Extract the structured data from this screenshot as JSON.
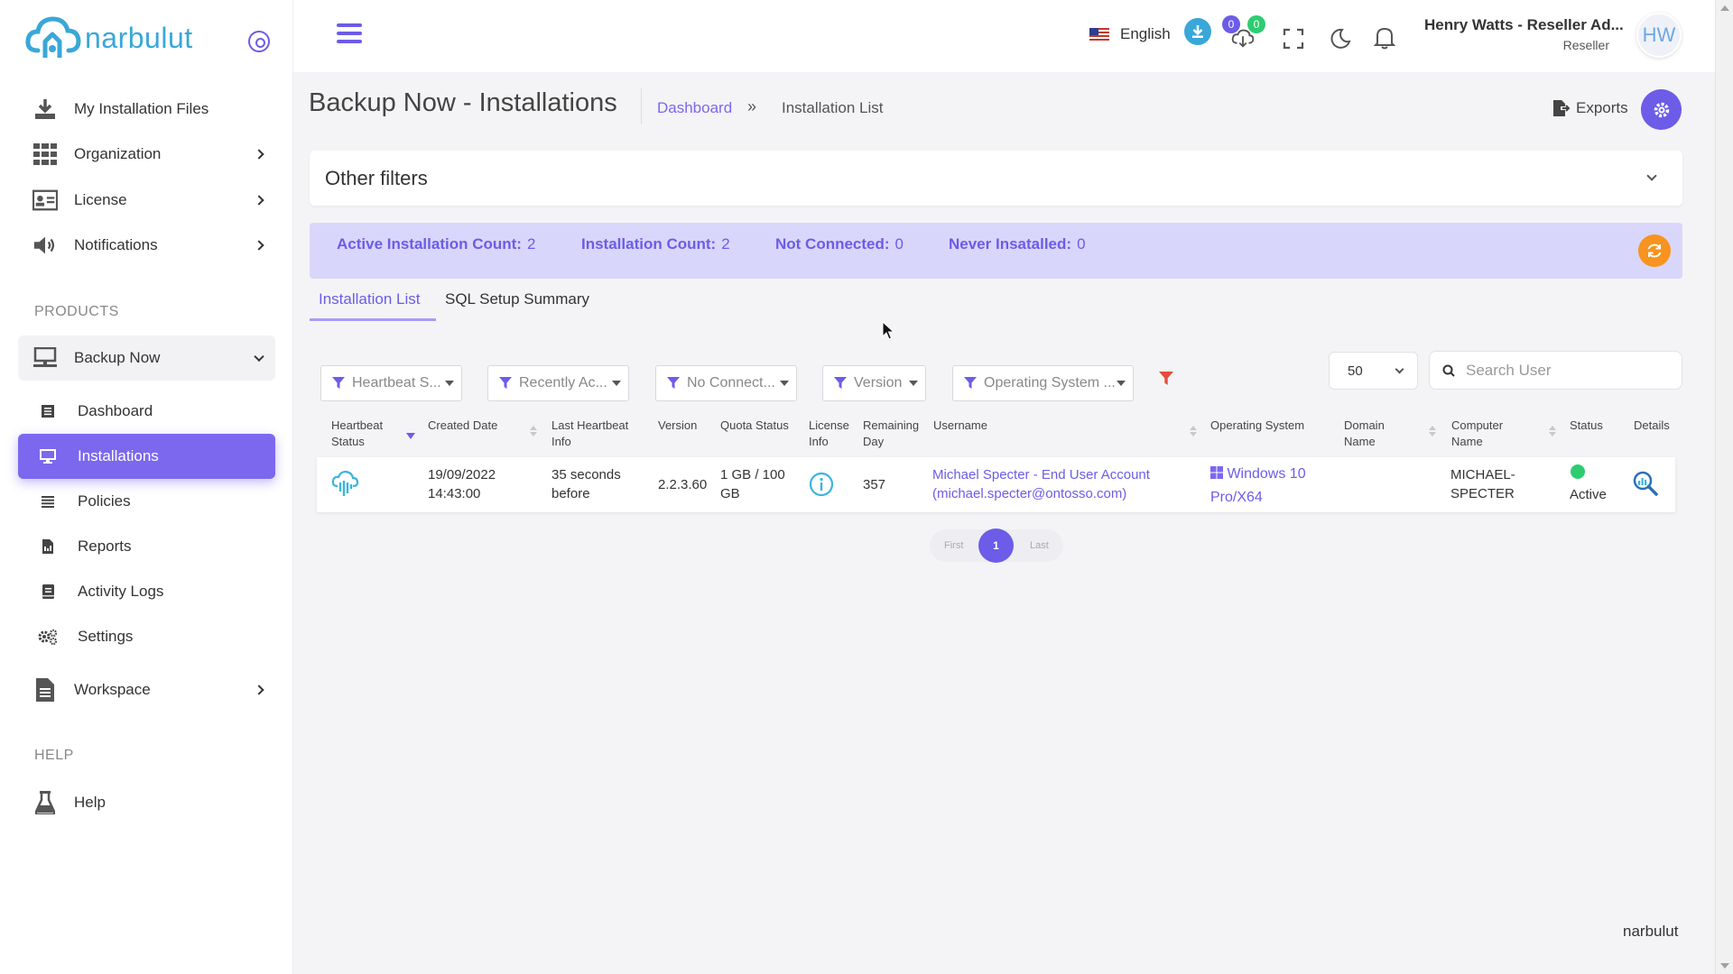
{
  "brand": {
    "name": "narbulut",
    "footer": "narbulut"
  },
  "sidebar": {
    "items": [
      {
        "label": "My Installation Files",
        "icon": "download-tray-icon"
      },
      {
        "label": "Organization",
        "icon": "grid-icon"
      },
      {
        "label": "License",
        "icon": "id-card-icon"
      },
      {
        "label": "Notifications",
        "icon": "speaker-icon"
      }
    ],
    "products_heading": "PRODUCTS",
    "product": {
      "label": "Backup Now",
      "icon": "monitor-network-icon"
    },
    "sub_items": [
      {
        "label": "Dashboard",
        "icon": "list-icon"
      },
      {
        "label": "Installations",
        "icon": "monitor-icon"
      },
      {
        "label": "Policies",
        "icon": "lines-icon"
      },
      {
        "label": "Reports",
        "icon": "report-icon"
      },
      {
        "label": "Activity Logs",
        "icon": "log-icon"
      },
      {
        "label": "Settings",
        "icon": "gears-icon"
      }
    ],
    "workspace": {
      "label": "Workspace",
      "icon": "document-icon"
    },
    "help_heading": "HELP",
    "help": {
      "label": "Help",
      "icon": "flask-icon"
    }
  },
  "topbar": {
    "language": "English",
    "badge_a": "0",
    "badge_b": "0",
    "user_name": "Henry Watts - Reseller Ad...",
    "user_role": "Reseller",
    "avatar_initials": "HW"
  },
  "page": {
    "title": "Backup Now - Installations",
    "breadcrumb_link": "Dashboard",
    "breadcrumb_sep": "»",
    "breadcrumb_current": "Installation List",
    "exports_label": "Exports"
  },
  "filters_card": {
    "title": "Other filters"
  },
  "stats": [
    {
      "label": "Active Installation Count:",
      "value": "2"
    },
    {
      "label": "Installation Count:",
      "value": "2"
    },
    {
      "label": "Not Connected:",
      "value": "0"
    },
    {
      "label": "Never Insatalled:",
      "value": "0"
    }
  ],
  "tabs": [
    {
      "label": "Installation List",
      "active": true
    },
    {
      "label": "SQL Setup Summary",
      "active": false
    }
  ],
  "filter_dropdowns": [
    "Heartbeat S...",
    "Recently Ac...",
    "No Connect...",
    "Version",
    "Operating System ..."
  ],
  "per_page": "50",
  "search": {
    "placeholder": "Search User"
  },
  "table": {
    "headers": {
      "heartbeat_1": "Heartbeat",
      "heartbeat_2": "Status",
      "created": "Created Date",
      "last_hb_1": "Last Heartbeat",
      "last_hb_2": "Info",
      "version": "Version",
      "quota": "Quota Status",
      "license_1": "License",
      "license_2": "Info",
      "remaining_1": "Remaining",
      "remaining_2": "Day",
      "username": "Username",
      "os": "Operating System",
      "domain_1": "Domain",
      "domain_2": "Name",
      "computer_1": "Computer",
      "computer_2": "Name",
      "status": "Status",
      "details": "Details"
    },
    "row": {
      "created_1": "19/09/2022",
      "created_2": "14:43:00",
      "last_hb_1": "35 seconds",
      "last_hb_2": "before",
      "version": "2.2.3.60",
      "quota_1": "1 GB / 100",
      "quota_2": "GB",
      "remaining": "357",
      "username_1": "Michael Specter - End User Account",
      "username_2": "(michael.specter@ontosso.com)",
      "os_1": "Windows 10",
      "os_2": "Pro/X64",
      "computer_1": "MICHAEL-",
      "computer_2": "SPECTER",
      "status": "Active"
    }
  },
  "pagination": {
    "first": "First",
    "current": "1",
    "last": "Last"
  },
  "colors": {
    "accent": "#6c5ce7",
    "brand": "#3aa7d8",
    "stats_bg": "#d9d6fb",
    "refresh": "#f7931e",
    "active_status": "#2ecc71"
  }
}
